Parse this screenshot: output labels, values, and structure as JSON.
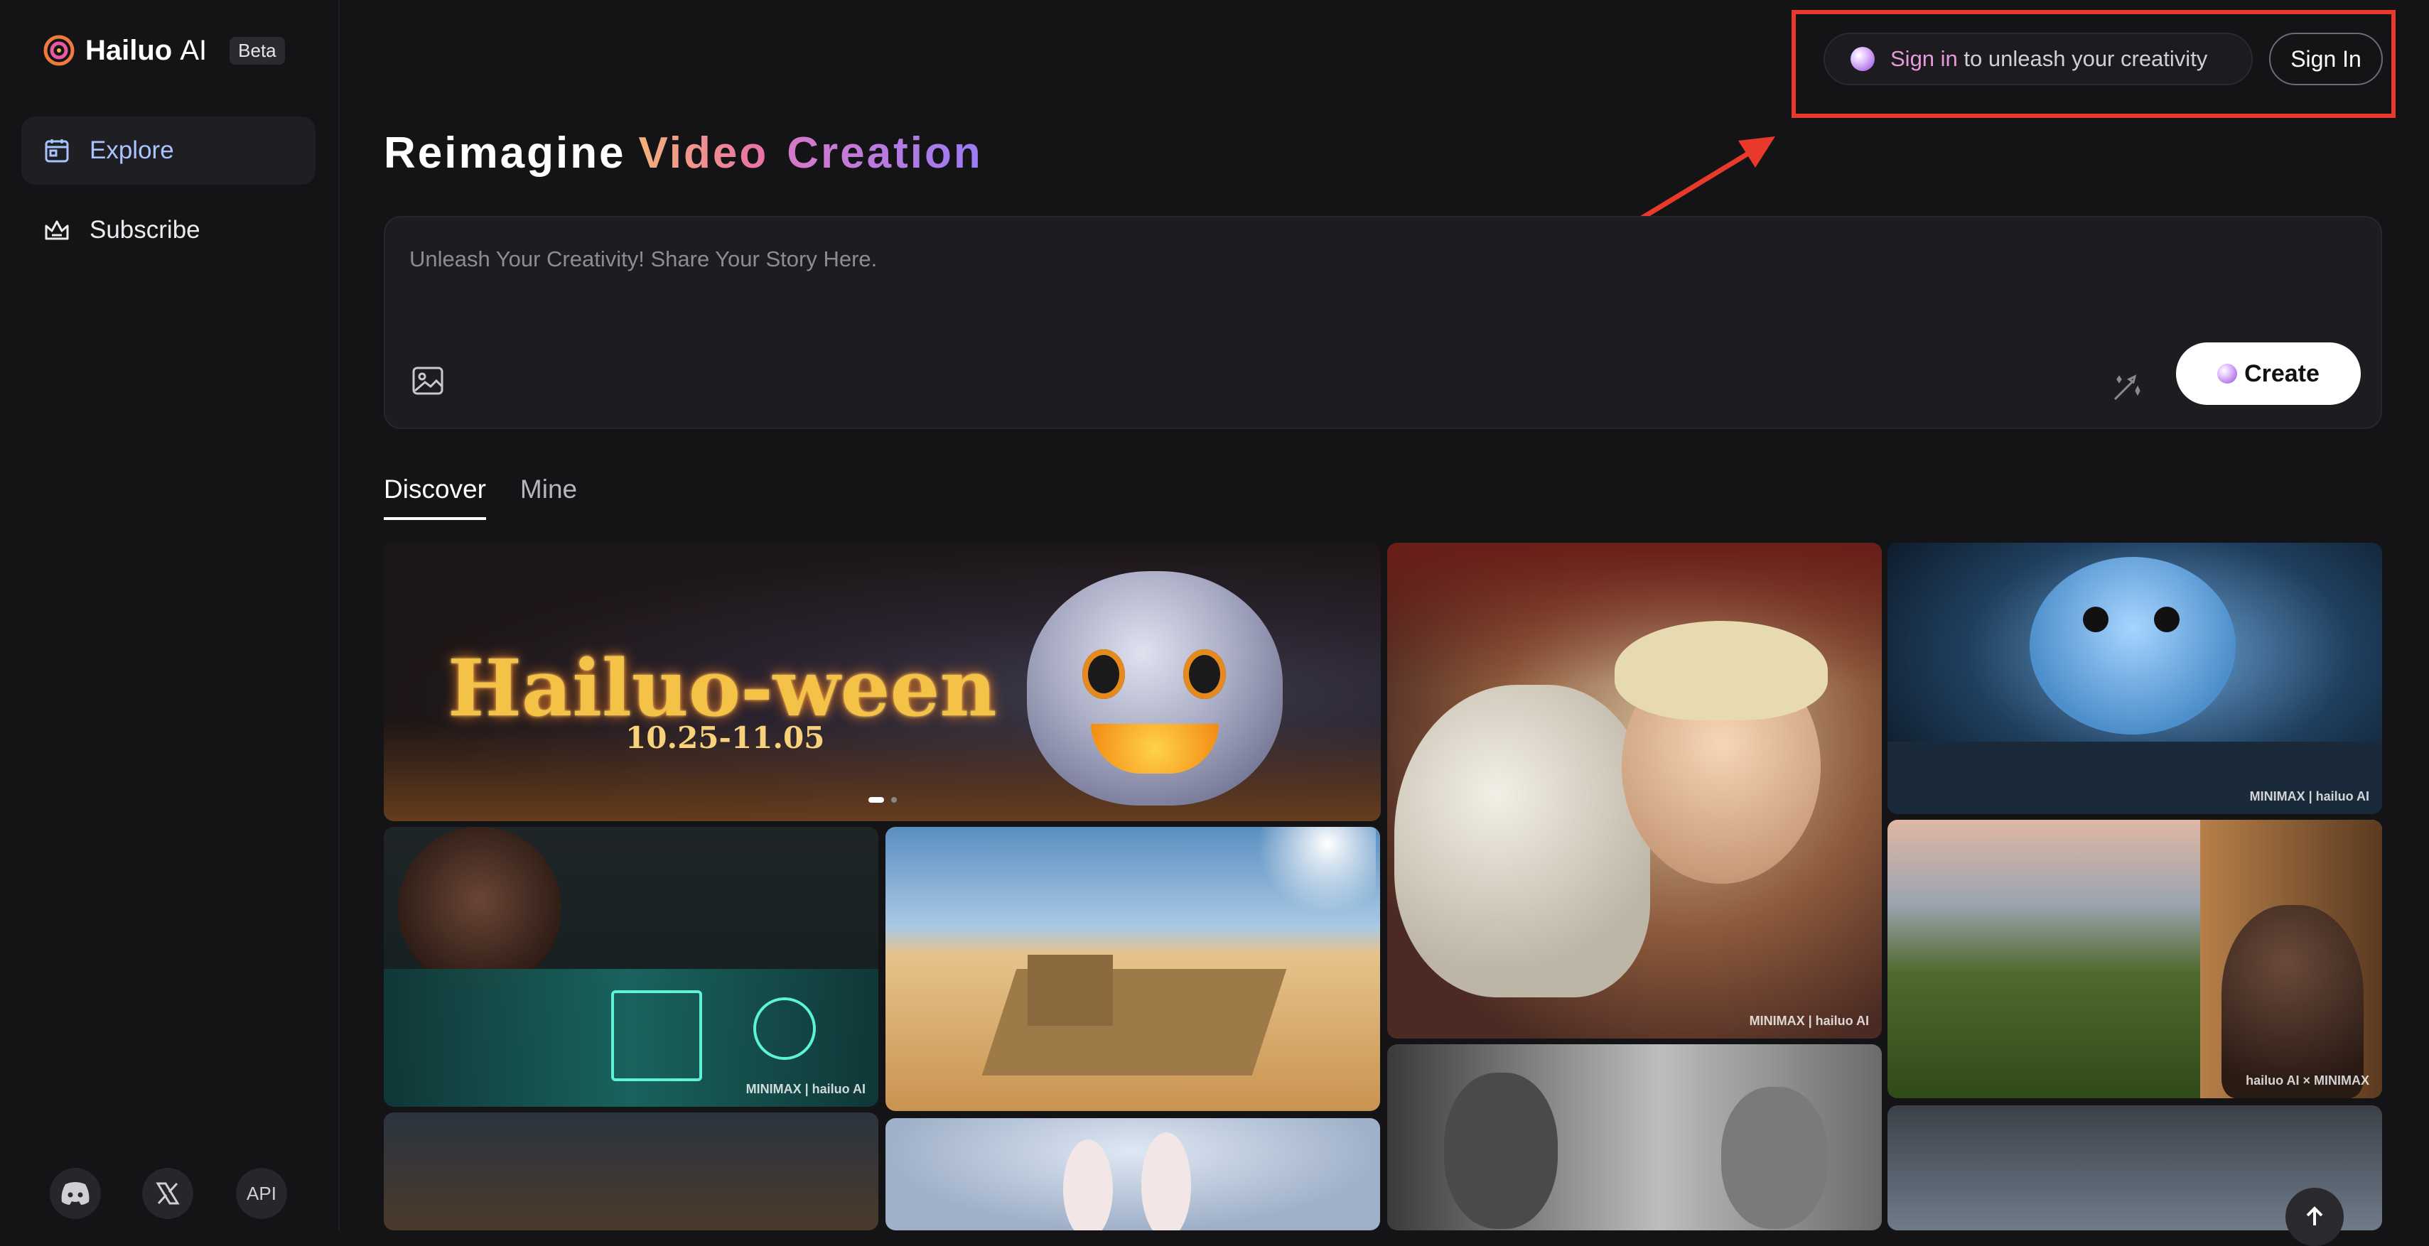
{
  "app": {
    "name_bold": "Hailuo",
    "name_thin": "AI",
    "badge": "Beta"
  },
  "sidebar": {
    "items": [
      {
        "label": "Explore",
        "icon": "calendar-icon",
        "active": true
      },
      {
        "label": "Subscribe",
        "icon": "crown-icon",
        "active": false
      }
    ],
    "social": [
      {
        "icon": "discord-icon"
      },
      {
        "icon": "x-icon"
      },
      {
        "label": "API"
      }
    ]
  },
  "topbar": {
    "promo_highlight": "Sign in",
    "promo_rest": " to unleash your creativity",
    "signin_label": "Sign In",
    "highlight_color": "#e8392b"
  },
  "hero": {
    "word1": "Reimagine",
    "word2": "Video",
    "word3": "Creation"
  },
  "prompt": {
    "placeholder": "Unleash Your Creativity! Share Your Story Here.",
    "create_label": "Create"
  },
  "tabs": [
    {
      "label": "Discover",
      "active": true
    },
    {
      "label": "Mine",
      "active": false
    }
  ],
  "banner": {
    "title": "Hailuo-ween",
    "dates": "10.25-11.05"
  },
  "watermarks": {
    "dragon": "MINIMAX | hailuo AI",
    "monster": "MINIMAX | hailuo AI",
    "field": "hailuo AI × MINIMAX",
    "hud": "MINIMAX | hailuo AI"
  }
}
